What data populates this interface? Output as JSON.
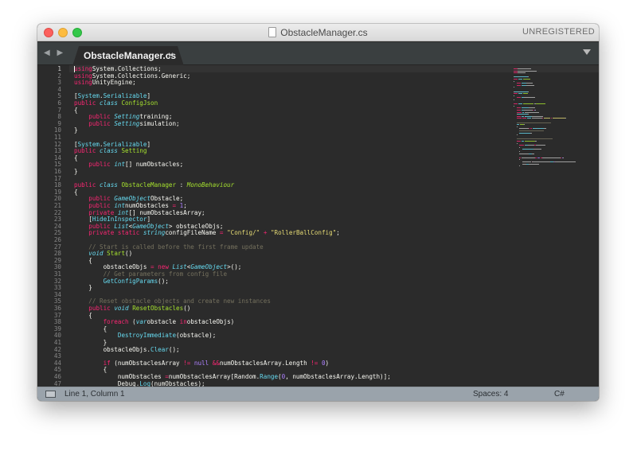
{
  "window": {
    "title": "ObstacleManager.cs",
    "registration": "UNREGISTERED"
  },
  "tabs": [
    {
      "label": "ObstacleManager.cs",
      "close": "×"
    }
  ],
  "tab_nav": "◀ ▶",
  "editor": {
    "language": "C#",
    "current_line": 1,
    "lines": [
      [
        [
          "k",
          "using"
        ],
        [
          "",
          "System.Collections;"
        ]
      ],
      [
        [
          "k",
          "using"
        ],
        [
          "",
          "System.Collections.Generic;"
        ]
      ],
      [
        [
          "k",
          "using"
        ],
        [
          "",
          "UnityEngine;"
        ]
      ],
      [],
      [
        [
          "",
          "["
        ],
        [
          "f",
          "System"
        ],
        [
          "",
          "."
        ],
        [
          "f",
          "Serializable"
        ],
        [
          "",
          "]"
        ]
      ],
      [
        [
          "k",
          "public"
        ],
        [
          "",
          ""
        ],
        [
          "t",
          "class"
        ],
        [
          "",
          ""
        ],
        [
          "cls",
          "ConfigJson"
        ]
      ],
      [
        [
          "",
          "{"
        ]
      ],
      [
        [
          "",
          "    "
        ],
        [
          "k",
          "public"
        ],
        [
          "",
          ""
        ],
        [
          "t",
          "Setting"
        ],
        [
          "",
          "training;"
        ]
      ],
      [
        [
          "",
          "    "
        ],
        [
          "k",
          "public"
        ],
        [
          "",
          ""
        ],
        [
          "t",
          "Setting"
        ],
        [
          "",
          "simulation;"
        ]
      ],
      [
        [
          "",
          "}"
        ]
      ],
      [],
      [
        [
          "",
          "["
        ],
        [
          "f",
          "System"
        ],
        [
          "",
          "."
        ],
        [
          "f",
          "Serializable"
        ],
        [
          "",
          "]"
        ]
      ],
      [
        [
          "k",
          "public"
        ],
        [
          "",
          ""
        ],
        [
          "t",
          "class"
        ],
        [
          "",
          ""
        ],
        [
          "cls",
          "Setting"
        ]
      ],
      [
        [
          "",
          "{"
        ]
      ],
      [
        [
          "",
          "    "
        ],
        [
          "k",
          "public"
        ],
        [
          "",
          ""
        ],
        [
          "t",
          "int"
        ],
        [
          "",
          "[] numObstacles;"
        ]
      ],
      [
        [
          "",
          "}"
        ]
      ],
      [],
      [
        [
          "k",
          "public"
        ],
        [
          "",
          ""
        ],
        [
          "t",
          "class"
        ],
        [
          "",
          ""
        ],
        [
          "cls",
          "ObstacleManager"
        ],
        [
          "",
          " : "
        ],
        [
          "base",
          "MonoBehaviour"
        ]
      ],
      [
        [
          "",
          "{"
        ]
      ],
      [
        [
          "",
          "    "
        ],
        [
          "k",
          "public"
        ],
        [
          "",
          ""
        ],
        [
          "t",
          "GameObject"
        ],
        [
          "",
          "Obstacle;"
        ]
      ],
      [
        [
          "",
          "    "
        ],
        [
          "k",
          "public"
        ],
        [
          "",
          ""
        ],
        [
          "t",
          "int"
        ],
        [
          "",
          "numObstacles "
        ],
        [
          "k",
          "="
        ],
        [
          "",
          ""
        ],
        [
          "n",
          "1"
        ],
        [
          "",
          ";"
        ]
      ],
      [
        [
          "",
          "    "
        ],
        [
          "k",
          "private"
        ],
        [
          "",
          ""
        ],
        [
          "t",
          "int"
        ],
        [
          "",
          "[] numObstaclesArray;"
        ]
      ],
      [
        [
          "",
          "    "
        ],
        [
          "",
          "["
        ],
        [
          "f",
          "HideInInspector"
        ],
        [
          "",
          "]"
        ]
      ],
      [
        [
          "",
          "    "
        ],
        [
          "k",
          "public"
        ],
        [
          "",
          ""
        ],
        [
          "t",
          "List"
        ],
        [
          "",
          "<"
        ],
        [
          "t",
          "GameObject"
        ],
        [
          "",
          "> obstacleObjs;"
        ]
      ],
      [
        [
          "",
          "    "
        ],
        [
          "k",
          "private"
        ],
        [
          "",
          ""
        ],
        [
          "k",
          "static"
        ],
        [
          "",
          ""
        ],
        [
          "t",
          "string"
        ],
        [
          "",
          "configFileName "
        ],
        [
          "k",
          "="
        ],
        [
          "",
          ""
        ],
        [
          "s",
          "\"Config/\""
        ],
        [
          "",
          ""
        ],
        [
          "k",
          "+"
        ],
        [
          "",
          ""
        ],
        [
          "s",
          "\"RollerBallConfig\""
        ],
        [
          "",
          ";"
        ]
      ],
      [],
      [
        [
          "",
          "    "
        ],
        [
          "c",
          "// Start is called before the first frame update"
        ]
      ],
      [
        [
          "",
          "    "
        ],
        [
          "t",
          "void"
        ],
        [
          "",
          ""
        ],
        [
          "cls",
          "Start"
        ],
        [
          "",
          "()"
        ]
      ],
      [
        [
          "",
          "    {"
        ]
      ],
      [
        [
          "",
          "        obstacleObjs "
        ],
        [
          "k",
          "="
        ],
        [
          "",
          ""
        ],
        [
          "k",
          "new"
        ],
        [
          "",
          ""
        ],
        [
          "t",
          "List"
        ],
        [
          "",
          "<"
        ],
        [
          "t",
          "GameObject"
        ],
        [
          "",
          ">();"
        ]
      ],
      [
        [
          "",
          "        "
        ],
        [
          "c",
          "// Get parameters from config file"
        ]
      ],
      [
        [
          "",
          "        "
        ],
        [
          "f",
          "GetConfigParams"
        ],
        [
          "",
          "();"
        ]
      ],
      [
        [
          "",
          "    }"
        ]
      ],
      [],
      [
        [
          "",
          "    "
        ],
        [
          "c",
          "// Reset obstacle objects and create new instances"
        ]
      ],
      [
        [
          "",
          "    "
        ],
        [
          "k",
          "public"
        ],
        [
          "",
          ""
        ],
        [
          "t",
          "void"
        ],
        [
          "",
          ""
        ],
        [
          "cls",
          "ResetObstacles"
        ],
        [
          "",
          "()"
        ]
      ],
      [
        [
          "",
          "    {"
        ]
      ],
      [
        [
          "",
          "        "
        ],
        [
          "k",
          "foreach"
        ],
        [
          "",
          " ("
        ],
        [
          "t",
          "var"
        ],
        [
          "",
          "obstacle "
        ],
        [
          "k",
          "in"
        ],
        [
          "",
          "obstacleObjs)"
        ]
      ],
      [
        [
          "",
          "        {"
        ]
      ],
      [
        [
          "",
          "            "
        ],
        [
          "f",
          "DestroyImmediate"
        ],
        [
          "",
          "(obstacle);"
        ]
      ],
      [
        [
          "",
          "        }"
        ]
      ],
      [
        [
          "",
          "        obstacleObjs."
        ],
        [
          "f",
          "Clear"
        ],
        [
          "",
          "();"
        ]
      ],
      [],
      [
        [
          "",
          "        "
        ],
        [
          "k",
          "if"
        ],
        [
          "",
          " (numObstaclesArray "
        ],
        [
          "k",
          "!="
        ],
        [
          "",
          ""
        ],
        [
          "n",
          "null"
        ],
        [
          "",
          ""
        ],
        [
          "k",
          "&&"
        ],
        [
          "",
          "numObstaclesArray.Length "
        ],
        [
          "k",
          "!="
        ],
        [
          "",
          ""
        ],
        [
          "n",
          "0"
        ],
        [
          "",
          ")"
        ]
      ],
      [
        [
          "",
          "        {"
        ]
      ],
      [
        [
          "",
          "            numObstacles "
        ],
        [
          "k",
          "="
        ],
        [
          "",
          "numObstaclesArray[Random."
        ],
        [
          "f",
          "Range"
        ],
        [
          "",
          "("
        ],
        [
          "n",
          "0"
        ],
        [
          "",
          ", numObstaclesArray.Length)];"
        ]
      ],
      [
        [
          "",
          "            Debug."
        ],
        [
          "f",
          "Log"
        ],
        [
          "",
          "(numObstacles);"
        ]
      ],
      [
        [
          "",
          "        }"
        ]
      ]
    ]
  },
  "status": {
    "position": "Line 1, Column 1",
    "indent": "Spaces: 4",
    "syntax": "C#"
  },
  "colors": {
    "editor_bg": "#2b2b2b",
    "keyword": "#f92672",
    "type": "#66d9ef",
    "comment": "#75715e",
    "string": "#e6db74",
    "number": "#ae81ff",
    "entity": "#a6e22e"
  }
}
